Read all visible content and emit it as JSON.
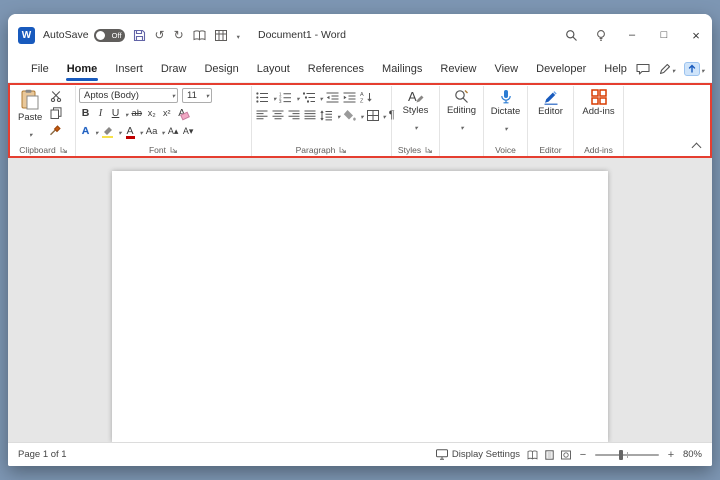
{
  "window": {
    "title": "Document1 - Word"
  },
  "titlebar": {
    "autosave_label": "AutoSave",
    "autosave_state": "Off"
  },
  "icons": {
    "word_logo": "W",
    "undo": "↺",
    "redo": "↻",
    "minimize": "–",
    "maximize": "□",
    "close": "×"
  },
  "menu": {
    "tabs": [
      "File",
      "Home",
      "Insert",
      "Draw",
      "Design",
      "Layout",
      "References",
      "Mailings",
      "Review",
      "View",
      "Developer",
      "Help"
    ],
    "active_tab": "Home"
  },
  "ribbon": {
    "clipboard": {
      "label": "Clipboard",
      "paste_label": "Paste"
    },
    "font": {
      "label": "Font",
      "family": "Aptos (Body)",
      "size": "11",
      "bold": "B",
      "italic": "I",
      "underline": "U",
      "strikethrough": "ab",
      "subscript": "x₂",
      "superscript": "x²",
      "clear": "A",
      "text_effects": "A",
      "font_color": "A",
      "change_case": "Aa",
      "grow": "A▴",
      "shrink": "A▾"
    },
    "paragraph": {
      "label": "Paragraph",
      "pilcrow": "¶"
    },
    "styles": {
      "label": "Styles",
      "button_label": "Styles"
    },
    "editing": {
      "button_label": "Editing"
    },
    "voice": {
      "label": "Voice",
      "button_label": "Dictate"
    },
    "editor": {
      "label": "Editor",
      "button_label": "Editor"
    },
    "addins": {
      "label": "Add-ins",
      "button_label": "Add-ins"
    }
  },
  "statusbar": {
    "page_info": "Page 1 of 1",
    "display_settings": "Display Settings",
    "zoom_out": "−",
    "zoom_in": "+",
    "zoom_level": "80%"
  }
}
